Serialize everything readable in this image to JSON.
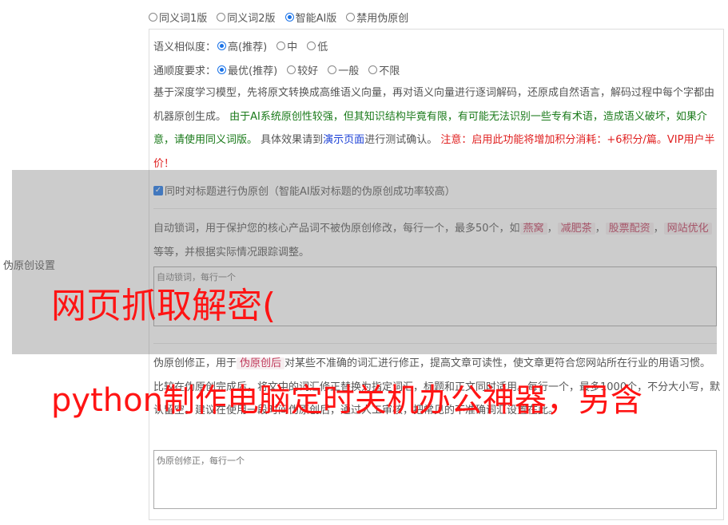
{
  "mode_options": [
    {
      "label": "同义词1版",
      "checked": false
    },
    {
      "label": "同义词2版",
      "checked": false
    },
    {
      "label": "智能AI版",
      "checked": true
    },
    {
      "label": "禁用伪原创",
      "checked": false
    }
  ],
  "similarity": {
    "label": "语义相似度：",
    "options": [
      {
        "label": "高(推荐)",
        "checked": true
      },
      {
        "label": "中",
        "checked": false
      },
      {
        "label": "低",
        "checked": false
      }
    ]
  },
  "fluency": {
    "label": "通顺度要求：",
    "options": [
      {
        "label": "最优(推荐)",
        "checked": true
      },
      {
        "label": "较好",
        "checked": false
      },
      {
        "label": "一般",
        "checked": false
      },
      {
        "label": "不限",
        "checked": false
      }
    ]
  },
  "description": {
    "part1": "基于深度学习模型，先将原文转换成高维语义向量，再对语义向量进行逐词解码，还原成自然语言，解码过程中每个字都由机器原创生成。",
    "green1": "由于AI系统原创性较强，但其知识结构毕竟有限，有可能无法识别一些专有术语，造成语义破坏，如果介意，请使用同义词版。",
    "part2": "具体效果请到",
    "link": "演示页面",
    "part3": "进行测试确认。",
    "red": "注意：启用此功能将增加积分消耗：+6积分/篇。VIP用户半价！"
  },
  "title_checkbox": {
    "label": "同时对标题进行伪原创（智能AI版对标题的伪原创成功率较高）",
    "checked": true
  },
  "section_label": "伪原创设置",
  "lock_words": {
    "text1": "自动锁词，用于保护您的核心产品词不被伪原创修改，每行一个，最多50个，如",
    "examples": [
      "燕窝",
      "减肥茶",
      "股票配资",
      "网站优化"
    ],
    "text2": "等等，并根据实际情况跟踪调整。",
    "placeholder": "自动锁词，每行一个"
  },
  "correction": {
    "text1": "伪原创修正，用于",
    "tag": "伪原创后",
    "text2": "对某些不准确的词汇进行修正，提高文章可读性，使文章更符合您网站所在行业的用语习惯。比较",
    "text3": "在伪原创完成后，将文中的词汇修正替换为指定词汇，标题和正文同时适用。每行一个，最多1000个，不分大小写，默认留空。建议在使用一段时间伪原创后，通过人工审核，把常见的不准确词汇设置在此。",
    "placeholder": "伪原创修正，每行一个"
  },
  "watermark": {
    "line1": "网页抓取解密(",
    "line2": "python制作电脑定时关机办公神器，另含"
  }
}
